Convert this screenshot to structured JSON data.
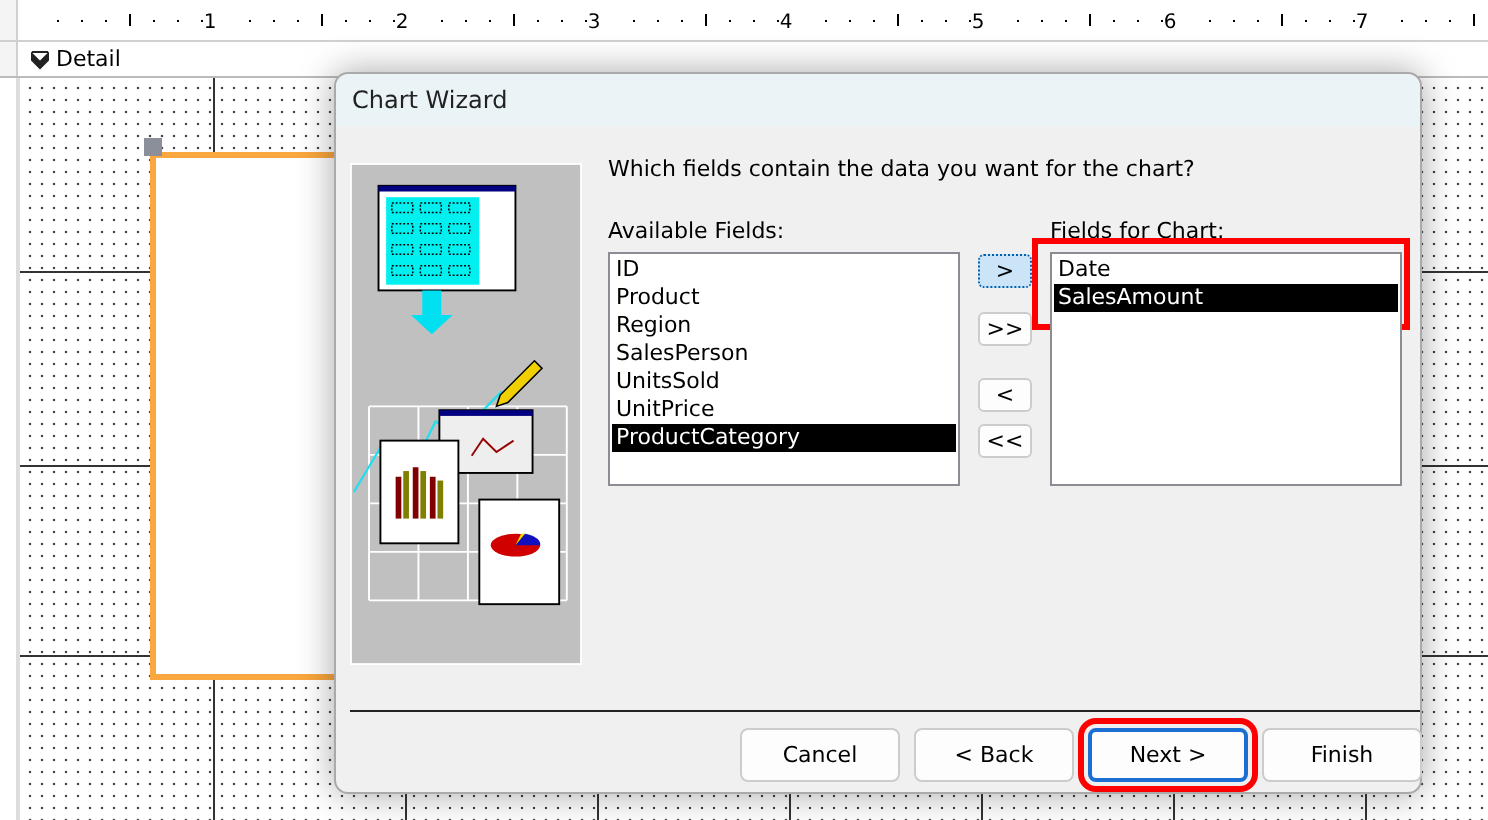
{
  "ruler": {
    "marks": [
      "1",
      "2",
      "3",
      "4",
      "5",
      "6",
      "7"
    ]
  },
  "section": {
    "label": "Detail"
  },
  "dialog": {
    "title": "Chart Wizard",
    "question": "Which fields contain the data you want for the chart?",
    "available": {
      "label": "Available Fields:",
      "highlighted": false,
      "items": [
        {
          "text": "ID",
          "selected": false
        },
        {
          "text": "Product",
          "selected": false
        },
        {
          "text": "Region",
          "selected": false
        },
        {
          "text": "SalesPerson",
          "selected": false
        },
        {
          "text": "UnitsSold",
          "selected": false
        },
        {
          "text": "UnitPrice",
          "selected": false
        },
        {
          "text": "ProductCategory",
          "selected": true
        }
      ]
    },
    "move_buttons": [
      {
        "label": ">",
        "focused": true
      },
      {
        "label": ">>",
        "focused": false
      },
      {
        "label": "<",
        "focused": false
      },
      {
        "label": "<<",
        "focused": false
      }
    ],
    "chart_fields": {
      "label": "Fields for Chart:",
      "highlighted": true,
      "items": [
        {
          "text": "Date",
          "selected": false
        },
        {
          "text": "SalesAmount",
          "selected": true
        }
      ]
    },
    "buttons": [
      {
        "label": "Cancel",
        "default": false,
        "highlighted": false
      },
      {
        "label": "< Back",
        "default": false,
        "highlighted": false
      },
      {
        "label": "Next >",
        "default": true,
        "highlighted": true
      },
      {
        "label": "Finish",
        "default": false,
        "highlighted": false
      }
    ]
  }
}
